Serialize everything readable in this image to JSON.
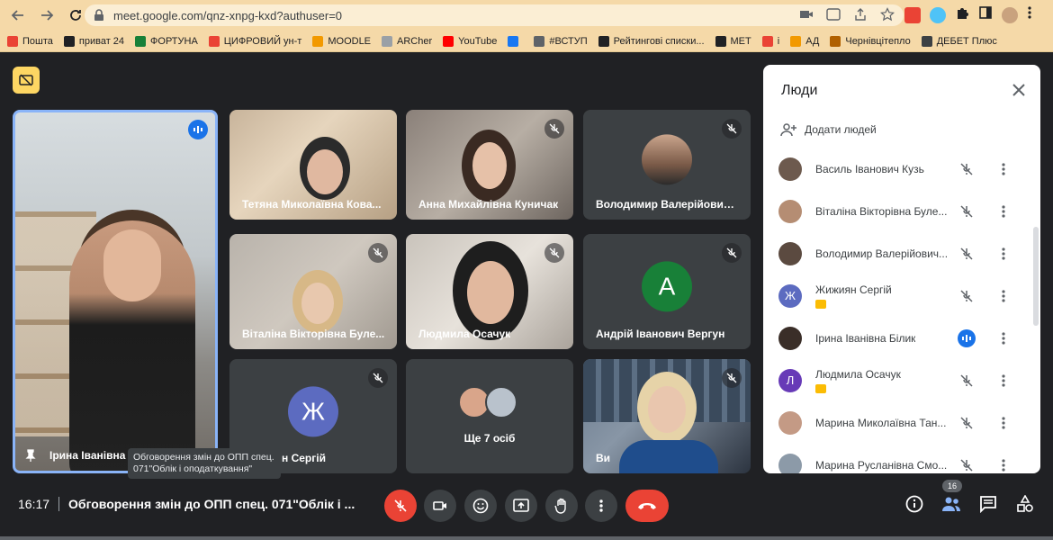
{
  "browser": {
    "url": "meet.google.com/qnz-xnpg-kxd?authuser=0",
    "bookmarks": [
      {
        "label": "Пошта",
        "color": "#ea4335"
      },
      {
        "label": "приват 24",
        "color": "#202124"
      },
      {
        "label": "ФОРТУНА",
        "color": "#188038"
      },
      {
        "label": "ЦИФРОВИЙ ун-т",
        "color": "#ea4335"
      },
      {
        "label": "MOODLE",
        "color": "#f29900"
      },
      {
        "label": "ARCher",
        "color": "#9aa0a6"
      },
      {
        "label": "YouTube",
        "color": "#ff0000"
      },
      {
        "label": "",
        "color": "#1877f2"
      },
      {
        "label": "#ВСТУП",
        "color": "#5f6368"
      },
      {
        "label": "Рейтингові списки...",
        "color": "#202124"
      },
      {
        "label": "МЕТ",
        "color": "#202124"
      },
      {
        "label": "і",
        "color": "#ea4335"
      },
      {
        "label": "АД",
        "color": "#f29900"
      },
      {
        "label": "Чернівцітепло",
        "color": "#b06000"
      },
      {
        "label": "ДЕБЕТ Плюс",
        "color": "#3c4043"
      }
    ]
  },
  "tiles": {
    "main": {
      "name": "Ірина Іванівна Б"
    },
    "t1": {
      "name": "Тетяна Миколаївна Кова..."
    },
    "t2": {
      "name": "Анна Михайлівна Куничак"
    },
    "t3": {
      "name": "Володимир Валерійович ..."
    },
    "t4": {
      "name": "Віталіна Вікторівна Буле..."
    },
    "t5": {
      "name": "Людмила Осачук"
    },
    "t6": {
      "name": "Андрій Іванович Вергун",
      "initial": "A",
      "color": "#188038"
    },
    "t7": {
      "name": "н Сергій",
      "initial": "Ж",
      "color": "#5c6bc0"
    },
    "t8": {
      "name": "Ще 7 осіб"
    },
    "t9": {
      "name": "Ви"
    }
  },
  "tooltip": "Обговорення змін до ОПП спец. 071\"Облік і оподаткування\"",
  "panel": {
    "title": "Люди",
    "add_people": "Додати людей",
    "people": [
      {
        "name": "Василь Іванович Кузь",
        "mic": "muted"
      },
      {
        "name": "Віталіна Вікторівна Буле...",
        "mic": "muted"
      },
      {
        "name": "Володимир Валерійович...",
        "mic": "muted"
      },
      {
        "name": "Жижиян Сергій",
        "mic": "muted",
        "initial": "Ж",
        "color": "#5c6bc0",
        "badge": true
      },
      {
        "name": "Ірина Іванівна Білик",
        "mic": "active"
      },
      {
        "name": "Людмила Осачук",
        "mic": "muted",
        "initial": "Л",
        "color": "#673ab7",
        "badge": true
      },
      {
        "name": "Марина Миколаївна Тан...",
        "mic": "muted"
      },
      {
        "name": "Марина Русланівна Смо...",
        "mic": "muted"
      }
    ]
  },
  "bottom": {
    "time": "16:17",
    "meeting_title": "Обговорення змін до ОПП спец. 071\"Облік і ...",
    "participants_count": "16"
  }
}
